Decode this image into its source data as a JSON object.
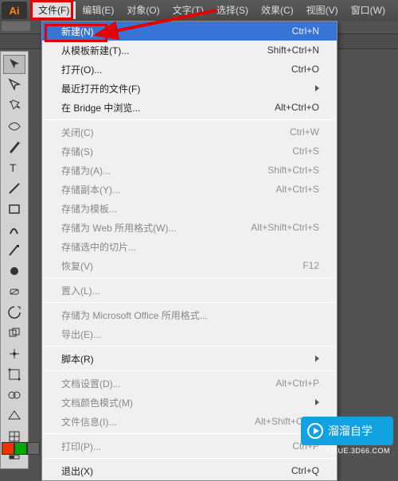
{
  "app": {
    "logo_text": "Ai"
  },
  "menubar": {
    "items": [
      {
        "label": "文件(F)",
        "active": true
      },
      {
        "label": "编辑(E)"
      },
      {
        "label": "对象(O)"
      },
      {
        "label": "文字(T)"
      },
      {
        "label": "选择(S)"
      },
      {
        "label": "效果(C)"
      },
      {
        "label": "视图(V)"
      },
      {
        "label": "窗口(W)"
      }
    ]
  },
  "file_menu": {
    "groups": [
      [
        {
          "label": "新建(N)...",
          "shortcut": "Ctrl+N",
          "enabled": true,
          "highlight": true
        },
        {
          "label": "从模板新建(T)...",
          "shortcut": "Shift+Ctrl+N",
          "enabled": true
        },
        {
          "label": "打开(O)...",
          "shortcut": "Ctrl+O",
          "enabled": true
        },
        {
          "label": "最近打开的文件(F)",
          "shortcut": "",
          "enabled": true,
          "submenu": true
        },
        {
          "label": "在 Bridge 中浏览...",
          "shortcut": "Alt+Ctrl+O",
          "enabled": true
        }
      ],
      [
        {
          "label": "关闭(C)",
          "shortcut": "Ctrl+W",
          "enabled": false
        },
        {
          "label": "存储(S)",
          "shortcut": "Ctrl+S",
          "enabled": false
        },
        {
          "label": "存储为(A)...",
          "shortcut": "Shift+Ctrl+S",
          "enabled": false
        },
        {
          "label": "存储副本(Y)...",
          "shortcut": "Alt+Ctrl+S",
          "enabled": false
        },
        {
          "label": "存储为模板...",
          "shortcut": "",
          "enabled": false
        },
        {
          "label": "存储为 Web 所用格式(W)...",
          "shortcut": "Alt+Shift+Ctrl+S",
          "enabled": false
        },
        {
          "label": "存储选中的切片...",
          "shortcut": "",
          "enabled": false
        },
        {
          "label": "恢复(V)",
          "shortcut": "F12",
          "enabled": false
        }
      ],
      [
        {
          "label": "置入(L)...",
          "shortcut": "",
          "enabled": false
        }
      ],
      [
        {
          "label": "存储为 Microsoft Office 所用格式...",
          "shortcut": "",
          "enabled": false
        },
        {
          "label": "导出(E)...",
          "shortcut": "",
          "enabled": false
        }
      ],
      [
        {
          "label": "脚本(R)",
          "shortcut": "",
          "enabled": true,
          "submenu": true
        }
      ],
      [
        {
          "label": "文档设置(D)...",
          "shortcut": "Alt+Ctrl+P",
          "enabled": false
        },
        {
          "label": "文档颜色模式(M)",
          "shortcut": "",
          "enabled": false,
          "submenu": true
        },
        {
          "label": "文件信息(I)...",
          "shortcut": "Alt+Shift+Ctrl+I",
          "enabled": false
        }
      ],
      [
        {
          "label": "打印(P)...",
          "shortcut": "Ctrl+P",
          "enabled": false
        }
      ],
      [
        {
          "label": "退出(X)",
          "shortcut": "Ctrl+Q",
          "enabled": true
        }
      ]
    ]
  },
  "tools": {
    "names": [
      "selection-tool",
      "direct-selection-tool",
      "magic-wand-tool",
      "lasso-tool",
      "pen-tool",
      "type-tool",
      "line-tool",
      "rectangle-tool",
      "paintbrush-tool",
      "pencil-tool",
      "blob-brush-tool",
      "eraser-tool",
      "rotate-tool",
      "scale-tool",
      "width-tool",
      "free-transform-tool",
      "shape-builder-tool",
      "perspective-grid-tool",
      "mesh-tool",
      "gradient-tool"
    ]
  },
  "watermark": {
    "text": "溜溜自学",
    "sub": "ZIXUE.3D66.COM"
  }
}
